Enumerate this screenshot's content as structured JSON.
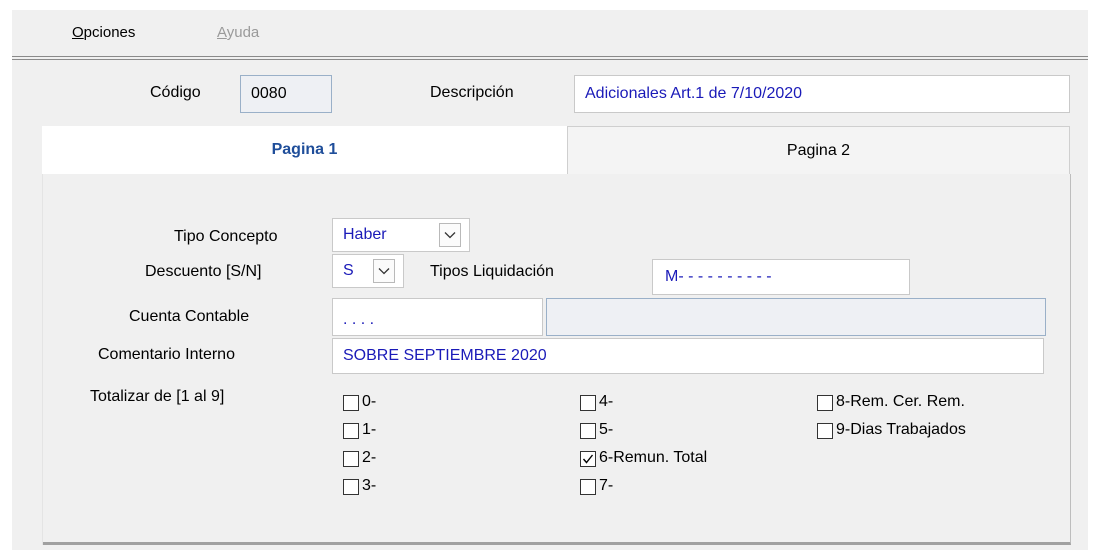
{
  "menu": {
    "opciones": "Opciones",
    "ayuda": "Ayuda"
  },
  "header": {
    "codigo_label": "Código",
    "codigo_value": "0080",
    "descripcion_label": "Descripción",
    "descripcion_value": "Adicionales Art.1 de 7/10/2020"
  },
  "tabs": [
    {
      "label": "Pagina 1",
      "active": true
    },
    {
      "label": "Pagina 2",
      "active": false
    }
  ],
  "form": {
    "tipo_concepto_label": "Tipo Concepto",
    "tipo_concepto_value": "Haber",
    "descuento_label": "Descuento [S/N]",
    "descuento_value": "S",
    "tipos_liquidacion_label": "Tipos Liquidación",
    "tipos_liquidacion_value": "M- - - - - - - - - -",
    "cuenta_contable_label": "Cuenta Contable",
    "cuenta_contable_value": ". . . .",
    "cuenta_contable_desc": "",
    "comentario_label": "Comentario Interno",
    "comentario_value": "SOBRE SEPTIEMBRE 2020",
    "totalizar_label": "Totalizar de [1 al  9]"
  },
  "checkboxes": [
    {
      "label": "0-",
      "checked": false
    },
    {
      "label": "1-",
      "checked": false
    },
    {
      "label": "2-",
      "checked": false
    },
    {
      "label": "3-",
      "checked": false
    },
    {
      "label": "4-",
      "checked": false
    },
    {
      "label": "5-",
      "checked": false
    },
    {
      "label": "6-Remun. Total",
      "checked": true
    },
    {
      "label": "7-",
      "checked": false
    },
    {
      "label": "8-Rem. Cer. Rem.",
      "checked": false
    },
    {
      "label": "9-Dias Trabajados",
      "checked": false
    }
  ],
  "colors": {
    "value_text": "#1a1ab8",
    "active_tab_text": "#1f4e9a",
    "disabled_menu": "#9a9a9a"
  }
}
